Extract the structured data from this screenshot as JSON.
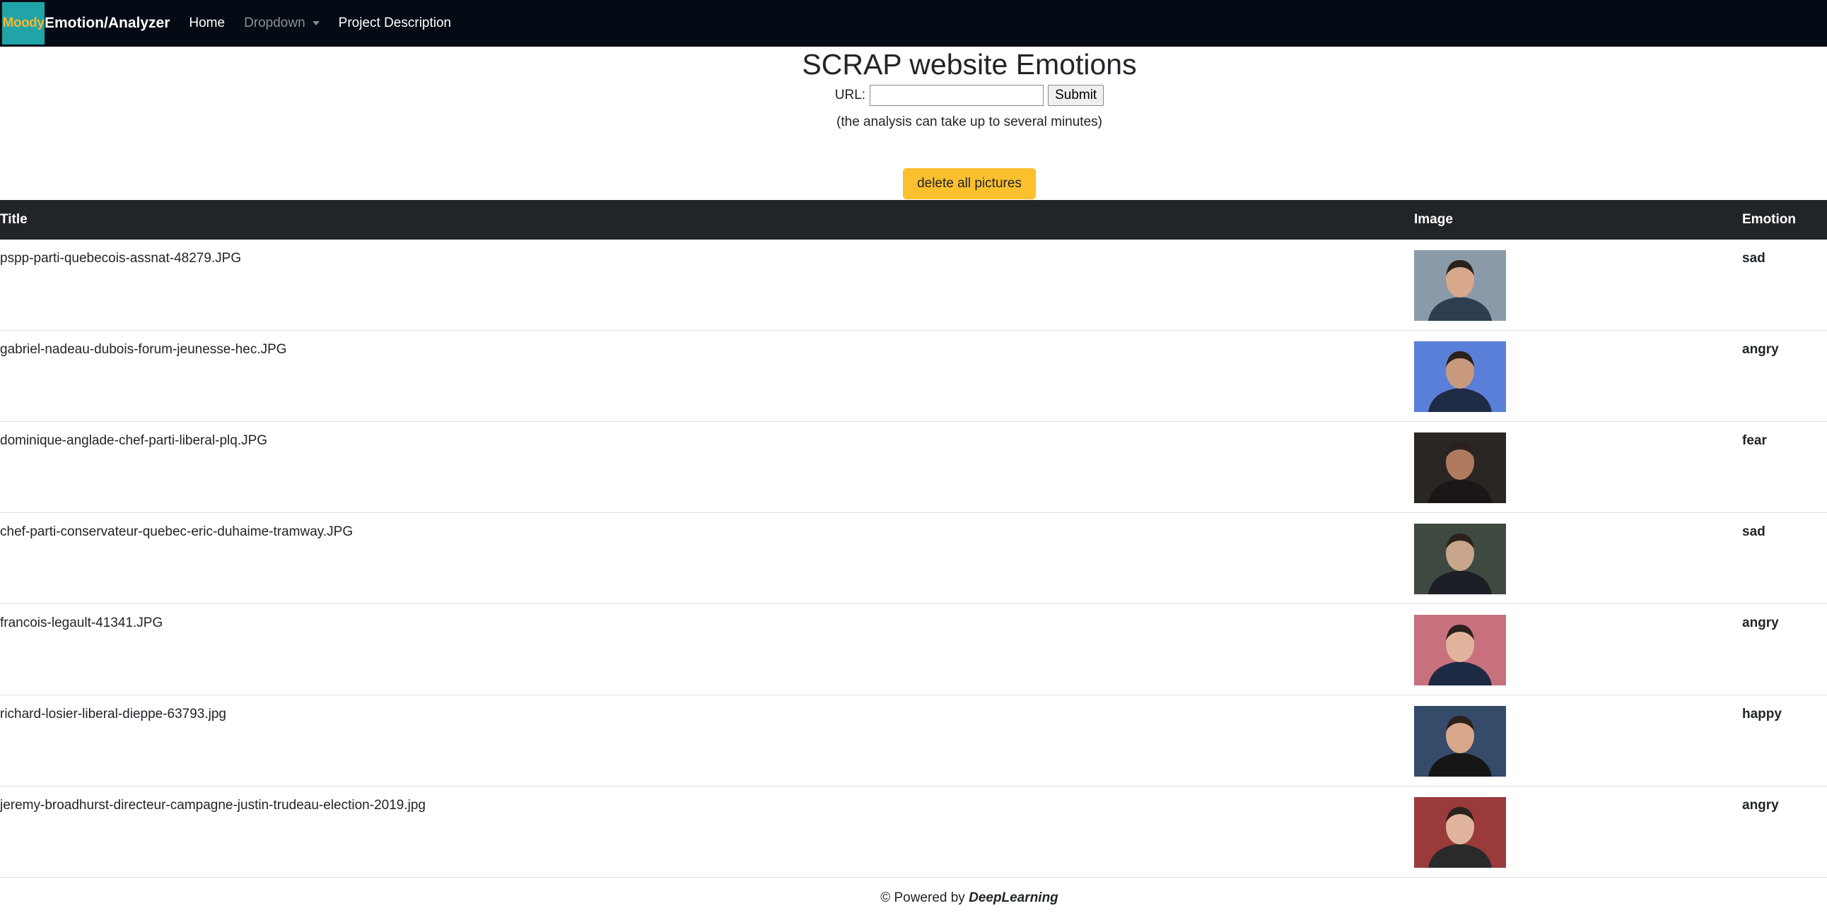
{
  "navbar": {
    "logo_text": "Moody",
    "brand": "Emotion/Analyzer",
    "links": {
      "home": "Home",
      "dropdown": "Dropdown",
      "project": "Project Description"
    }
  },
  "header": {
    "title": "SCRAP website Emotions",
    "url_label": "URL:",
    "url_value": "",
    "submit_label": "Submit",
    "note": "(the analysis can take up to several minutes)",
    "delete_label": "delete all pictures"
  },
  "table": {
    "columns": {
      "title": "Title",
      "image": "Image",
      "emotion": "Emotion"
    },
    "rows": [
      {
        "title": "pspp-parti-quebecois-assnat-48279.JPG",
        "emotion": "sad",
        "bg": "#8a9aa8",
        "fg": "#2c3e50",
        "skin": "#d8a88a"
      },
      {
        "title": "gabriel-nadeau-dubois-forum-jeunesse-hec.JPG",
        "emotion": "angry",
        "bg": "#5a7fd8",
        "fg": "#1f2a44",
        "skin": "#c99a7e"
      },
      {
        "title": "dominique-anglade-chef-parti-liberal-plq.JPG",
        "emotion": "fear",
        "bg": "#2a2624",
        "fg": "#1a1716",
        "skin": "#b07a5e"
      },
      {
        "title": "chef-parti-conservateur-quebec-eric-duhaime-tramway.JPG",
        "emotion": "sad",
        "bg": "#3e4a40",
        "fg": "#1c1f26",
        "skin": "#c9a58c"
      },
      {
        "title": "francois-legault-41341.JPG",
        "emotion": "angry",
        "bg": "#c8707e",
        "fg": "#1d2a44",
        "skin": "#e0b49c"
      },
      {
        "title": "richard-losier-liberal-dieppe-63793.jpg",
        "emotion": "happy",
        "bg": "#364a6a",
        "fg": "#161616",
        "skin": "#d8a88a"
      },
      {
        "title": "jeremy-broadhurst-directeur-campagne-justin-trudeau-election-2019.jpg",
        "emotion": "angry",
        "bg": "#9a3a3a",
        "fg": "#2a2a2a",
        "skin": "#e0b49c"
      }
    ]
  },
  "footer": {
    "prefix": "© Powered by ",
    "brand": "DeepLearning"
  }
}
